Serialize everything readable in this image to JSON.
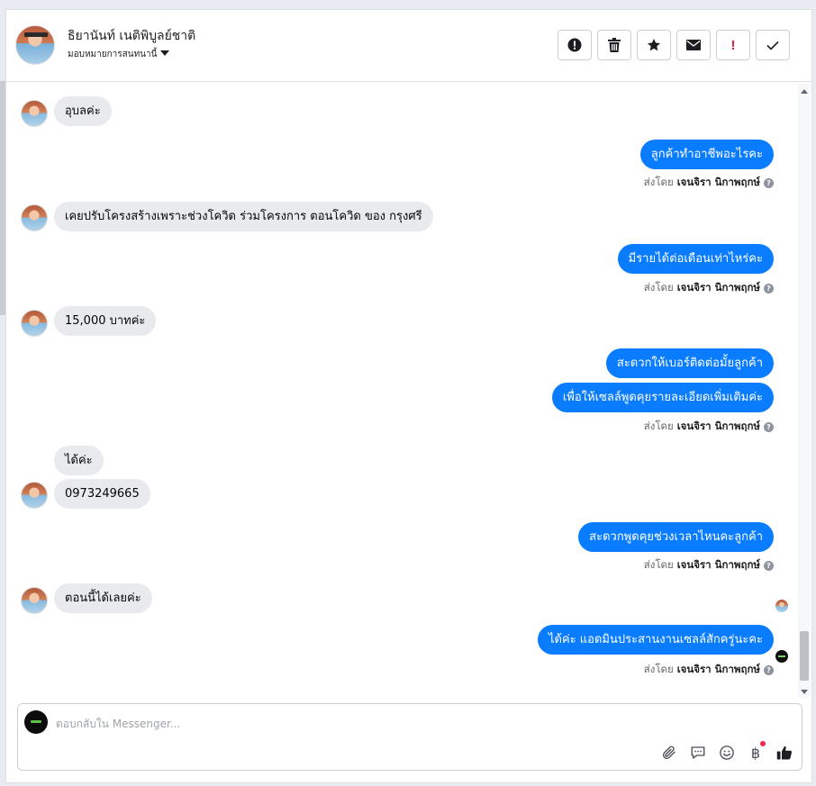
{
  "header": {
    "contact_name": "ธิยานันท์ เนติพิบูลย์ชาติ",
    "assign_label": "มอบหมายการสนทนานี้",
    "actions": [
      {
        "name": "spam-button",
        "icon": "exclamation-circle-icon"
      },
      {
        "name": "delete-button",
        "icon": "trash-icon"
      },
      {
        "name": "star-button",
        "icon": "star-icon"
      },
      {
        "name": "mark-unread-button",
        "icon": "envelope-icon"
      },
      {
        "name": "follow-up-button",
        "icon": "red-exclamation-icon",
        "label": "!"
      },
      {
        "name": "mark-done-button",
        "icon": "check-icon"
      }
    ]
  },
  "messages": [
    {
      "from": "customer",
      "text": "อุบลค่ะ"
    },
    {
      "from": "page",
      "text": "ลูกค้าทำอาชีพอะไรคะ"
    },
    {
      "from": "customer",
      "text": "เคยปรับโครงสร้างเพราะช่วงโควิด ร่วมโครงการ ตอนโควิด ของ กรุงศรี"
    },
    {
      "from": "page",
      "text": "มีรายได้ต่อเดือนเท่าไหร่คะ"
    },
    {
      "from": "customer",
      "text": "15,000 บาทค่ะ"
    },
    {
      "from": "page",
      "text": "สะดวกให้เบอร์ติดต่อมั้ยลูกค้า"
    },
    {
      "from": "page",
      "text": "เพื่อให้เซลล์พูดคุยรายละเอียดเพิ่มเติมค่ะ"
    },
    {
      "from": "customer",
      "text": "ได้ค่ะ"
    },
    {
      "from": "customer",
      "text": "0973249665"
    },
    {
      "from": "page",
      "text": "สะดวกพูดคุยช่วงเวลาไหนคะลูกค้า"
    },
    {
      "from": "customer",
      "text": "ตอนนี้ได้เลยค่ะ"
    },
    {
      "from": "page",
      "text": "ได้ค่ะ แอดมินประสานงานเซลล์สักครู่นะคะ"
    }
  ],
  "sent_by": {
    "prefix": "ส่งโดย",
    "agent": "เจนจิรา นิกาพฤกษ์",
    "help": "?"
  },
  "composer": {
    "placeholder": "ตอบกลับใน Messenger...",
    "baht_symbol": "฿"
  },
  "colors": {
    "outgoing_bubble": "#0a7cff",
    "incoming_bubble": "#e9eaed",
    "notification_dot": "#f02849"
  }
}
